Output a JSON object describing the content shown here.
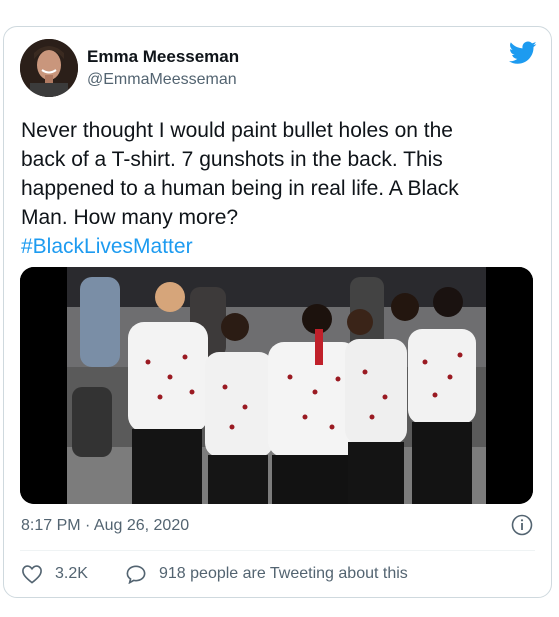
{
  "author": {
    "name": "Emma Meesseman",
    "handle": "@EmmaMeesseman",
    "avatar_icon": "avatar-photo"
  },
  "brand": {
    "icon": "twitter-bird-icon",
    "color": "#1d9bf0"
  },
  "tweet": {
    "lines": [
      "Never thought I would paint bullet holes on the",
      "back of a T-shirt. 7 gunshots in the back. This",
      "happened to a human being in real life. A Black",
      "Man. How many more?"
    ],
    "hashtag": "#BlackLivesMatter"
  },
  "media": {
    "icon": "photo-players-in-painted-shirts"
  },
  "timestamp": "8:17 PM · Aug 26, 2020",
  "actions": {
    "like_count": "3.2K",
    "tweeting_text": "918 people are Tweeting about this"
  },
  "colors": {
    "text": "#0f1419",
    "secondary": "#536471",
    "link": "#1d9bf0",
    "border": "#cfd9de"
  }
}
